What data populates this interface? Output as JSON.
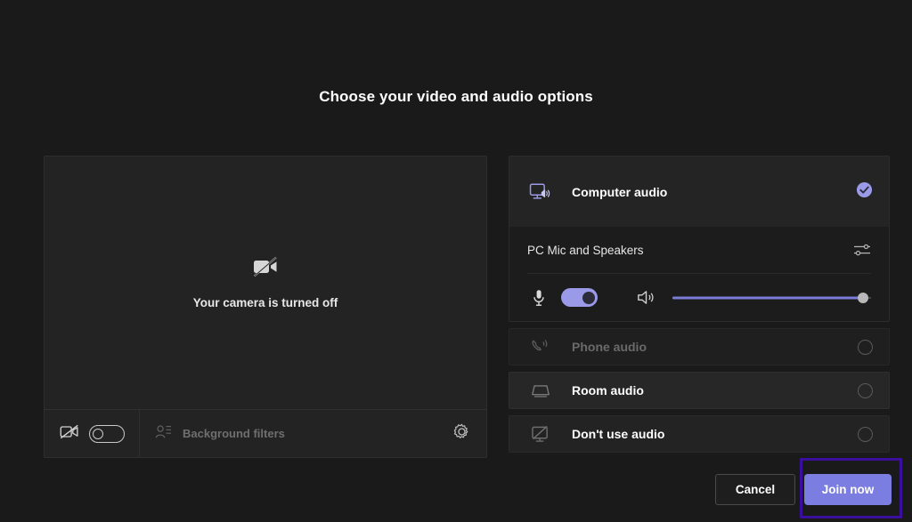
{
  "page": {
    "title": "Choose your video and audio options",
    "background_color": "#1a1a1a"
  },
  "video_preview": {
    "camera_status_text": "Your camera is turned off",
    "camera_off_icon": "video-off-icon",
    "toolbar": {
      "camera_icon": "video-off-icon",
      "camera_toggle_state": "off",
      "background_filters_label": "Background filters",
      "background_filters_icon": "background-filters-icon",
      "settings_icon": "gear-icon"
    }
  },
  "audio_options": {
    "computer_audio": {
      "label": "Computer audio",
      "icon": "computer-audio-icon",
      "selected": true,
      "check_icon": "check-circle-icon",
      "accent_color": "#9a9ae8"
    },
    "device": {
      "name": "PC Mic and Speakers",
      "settings_icon": "audio-settings-sliders-icon",
      "mic_icon": "microphone-icon",
      "mic_toggle_state": "on",
      "speaker_icon": "speaker-icon",
      "volume_percent": 96
    },
    "other_options": [
      {
        "label": "Phone audio",
        "icon": "phone-audio-icon",
        "selected": false,
        "dimmed": true
      },
      {
        "label": "Room audio",
        "icon": "room-audio-icon",
        "selected": false,
        "dimmed": false
      },
      {
        "label": "Don't use audio",
        "icon": "no-audio-icon",
        "selected": false,
        "dimmed": false
      }
    ]
  },
  "footer": {
    "cancel_label": "Cancel",
    "join_label": "Join now",
    "join_button_color": "#7b7ee0",
    "highlight_color": "#3b0f9e"
  }
}
